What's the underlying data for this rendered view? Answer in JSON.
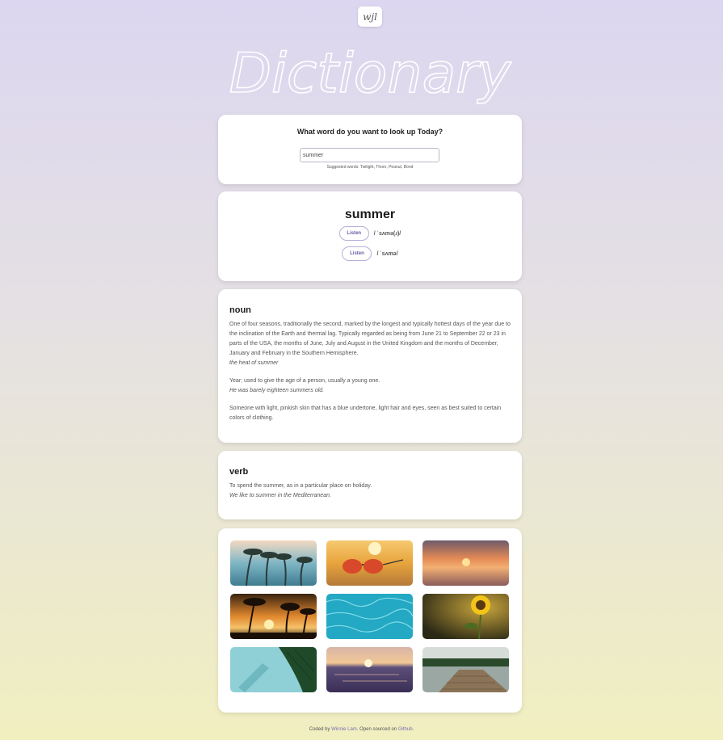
{
  "logo": {
    "text": "wjl"
  },
  "header": {
    "title": "Dictionary"
  },
  "search": {
    "question": "What word do you want to look up Today?",
    "value": "summer",
    "suggestions": "Suggested words: Twilight, Thorn, Peanut, Bond"
  },
  "word": {
    "headword": "summer",
    "phonetics": [
      {
        "button": "Listen",
        "text": "/ ˈsʌmə(ɹ)/"
      },
      {
        "button": "Listen",
        "text": "/ ˈsʌmə/"
      }
    ]
  },
  "meanings": [
    {
      "part_of_speech": "noun",
      "definitions": [
        {
          "definition": "One of four seasons, traditionally the second, marked by the longest and typically hottest days of the year due to the inclination of the Earth and thermal lag. Typically regarded as being from June 21 to September 22 or 23 in parts of the USA, the months of June, July and August in the United Kingdom and the months of December, January and February in the Southern Hemisphere.",
          "example": "the heat of summer"
        },
        {
          "definition": "Year; used to give the age of a person, usually a young one.",
          "example": "He was barely eighteen summers old."
        },
        {
          "definition": "Someone with light, pinkish skin that has a blue undertone, light hair and eyes, seen as best suited to certain colors of clothing.",
          "example": ""
        }
      ]
    },
    {
      "part_of_speech": "verb",
      "definitions": [
        {
          "definition": "To spend the summer, as in a particular place on holiday.",
          "example": "We like to summer in the Mediterranean."
        }
      ]
    }
  ],
  "photos": [
    {
      "name": "palm-trees-photo"
    },
    {
      "name": "sunglasses-beach-photo"
    },
    {
      "name": "sunset-sea-photo"
    },
    {
      "name": "palm-sunset-photo"
    },
    {
      "name": "pool-water-photo"
    },
    {
      "name": "sunflower-photo"
    },
    {
      "name": "palm-leaf-pool-photo"
    },
    {
      "name": "ocean-sunset-photo"
    },
    {
      "name": "lake-dock-photo"
    }
  ],
  "footer": {
    "prefix": "Coded by",
    "author": "Winnie Lam",
    "middle": ". Open sourced on",
    "repo": "Github",
    "suffix": "."
  }
}
